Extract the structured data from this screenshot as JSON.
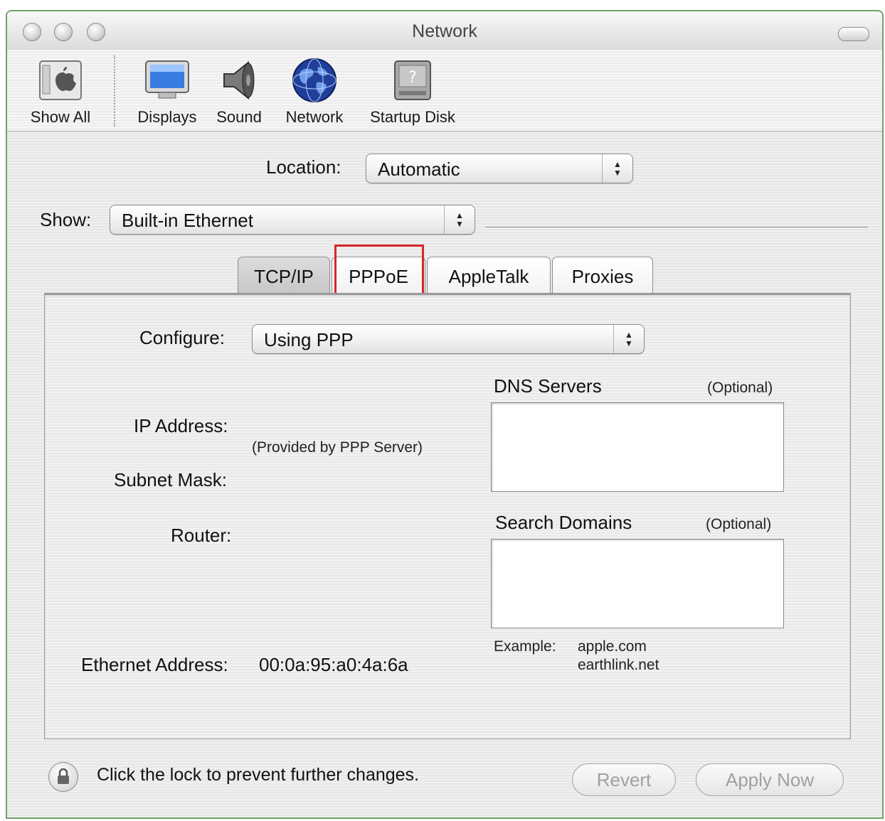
{
  "window": {
    "title": "Network"
  },
  "toolbar": {
    "items": [
      {
        "label": "Show All",
        "icon": "apple-system-icon"
      },
      {
        "label": "Displays",
        "icon": "display-icon"
      },
      {
        "label": "Sound",
        "icon": "speaker-icon"
      },
      {
        "label": "Network",
        "icon": "globe-icon"
      },
      {
        "label": "Startup Disk",
        "icon": "hard-disk-icon"
      }
    ]
  },
  "location": {
    "label": "Location:",
    "value": "Automatic"
  },
  "show": {
    "label": "Show:",
    "value": "Built-in Ethernet"
  },
  "tabs": [
    {
      "label": "TCP/IP",
      "selected": true
    },
    {
      "label": "PPPoE",
      "selected": false,
      "highlighted": true
    },
    {
      "label": "AppleTalk",
      "selected": false
    },
    {
      "label": "Proxies",
      "selected": false
    }
  ],
  "tcpip": {
    "configure_label": "Configure:",
    "configure_value": "Using PPP",
    "ip_address_label": "IP Address:",
    "provided_note": "(Provided by PPP Server)",
    "subnet_mask_label": "Subnet Mask:",
    "router_label": "Router:",
    "dns_label": "DNS Servers",
    "dns_optional": "(Optional)",
    "dns_value": "",
    "search_domains_label": "Search Domains",
    "search_optional": "(Optional)",
    "search_value": "",
    "example_label": "Example:",
    "example_values": [
      "apple.com",
      "earthlink.net"
    ],
    "ethernet_label": "Ethernet Address:",
    "ethernet_value": "00:0a:95:a0:4a:6a"
  },
  "footer": {
    "lock_text": "Click the lock to prevent further changes.",
    "revert_label": "Revert",
    "apply_label": "Apply Now"
  },
  "colors": {
    "highlight": "#d9252b",
    "window_border": "#6fa36a"
  }
}
